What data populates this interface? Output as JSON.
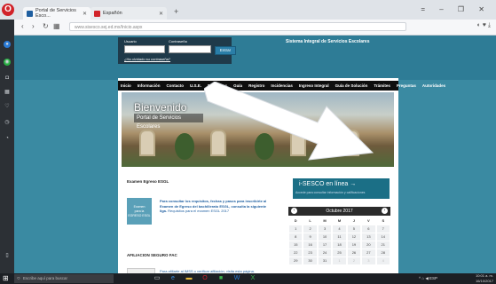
{
  "browser": {
    "tabs": [
      {
        "label": "Portal de Servicios Esco...",
        "favicon_color": "#1f5fa0"
      },
      {
        "label": "Españón",
        "favicon_color": "#d1232a"
      }
    ],
    "new_tab": "+",
    "address": "www.sisesco.sej.ed.mx/Inicio.aspx",
    "address_host_bold": "sej.ed.mx",
    "window_controls": "= – ❐ ✕"
  },
  "site": {
    "system_name": "Sistema Integral de Servicios Escolares",
    "login": {
      "user_label": "Usuario",
      "password_label": "Contraseña",
      "enter_button": "Entrar",
      "forgot_link": "¿Ha olvidado su contraseña?"
    },
    "menu": [
      "Inicio",
      "Información",
      "Contacto",
      "U.S.E.",
      "Preguntas",
      "Guía",
      "Registro",
      "Incidencias",
      "Ingreso Integral",
      "Guía de Solución",
      "Trámites",
      "Preguntas",
      "Autoridades"
    ],
    "banner": {
      "welcome": "Bienvenido",
      "portal": "Portal de Servicios Escolares"
    },
    "examen": {
      "title": "Examen Egreso ESGL",
      "image_lines": [
        "Examen",
        "para la",
        "EGRESO ESGL"
      ],
      "text_highlight": "Para consultar los requisitos, fechas y pasos para inscribirte al Examen de Egreso del bachillerato ESGL, consulta la siguiente liga.",
      "text_rest": " Requisitos para el examen ESGL 2017"
    },
    "afiliacion": {
      "title": "AFILIACION SEGURO FAC",
      "text": "Para afiliarte al IMSS o verificar afiliación, visita esta página."
    },
    "isesco": {
      "title": "i-SESCO en línea →",
      "subtitle": "Accede para consultar información y calificaciones"
    },
    "calendar": {
      "month": "Octubre 2017",
      "prev": "‹",
      "next": "›",
      "weekdays": [
        "D",
        "L",
        "M",
        "M",
        "J",
        "V",
        "S"
      ],
      "days": [
        [
          "1",
          "2",
          "3",
          "4",
          "5",
          "6",
          "7"
        ],
        [
          "8",
          "9",
          "10",
          "11",
          "12",
          "13",
          "14"
        ],
        [
          "15",
          "16",
          "17",
          "18",
          "19",
          "20",
          "21"
        ],
        [
          "22",
          "23",
          "24",
          "25",
          "26",
          "27",
          "28"
        ],
        [
          "29",
          "30",
          "31",
          "1",
          "2",
          "3",
          "4"
        ]
      ]
    }
  },
  "taskbar": {
    "search_placeholder": "Escribe aquí para buscar",
    "tray": "^ ⌂ ◀ ESP",
    "time": "10:01 a. m.",
    "date": "16/10/2017"
  },
  "colors": {
    "page_bg": "#3a8aa2",
    "accent": "#1b6f86",
    "opera_red": "#d1232a",
    "arrow": "#ffffff"
  }
}
